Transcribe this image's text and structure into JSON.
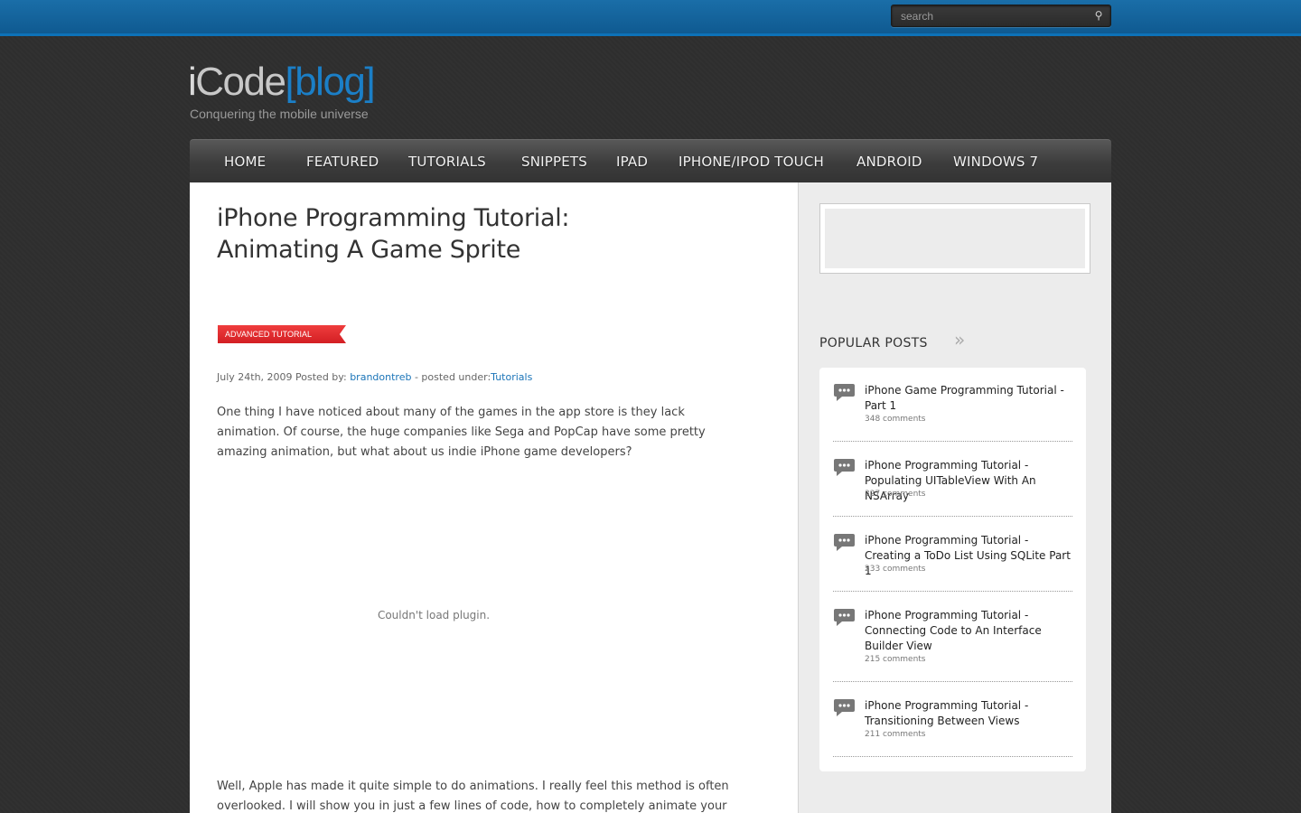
{
  "search": {
    "placeholder": "search"
  },
  "logo": {
    "i": "i",
    "code": "Code",
    "blog": "[blog]",
    "tagline": "Conquering the mobile universe"
  },
  "nav": [
    {
      "label": "HOME"
    },
    {
      "label": "FEATURED"
    },
    {
      "label": "TUTORIALS"
    },
    {
      "label": "SNIPPETS"
    },
    {
      "label": "IPAD"
    },
    {
      "label": "IPHONE/IPOD TOUCH"
    },
    {
      "label": "ANDROID"
    },
    {
      "label": "WINDOWS 7"
    }
  ],
  "post": {
    "title_line1": "iPhone Programming Tutorial:",
    "title_line2": "Animating A Game Sprite",
    "badge": "ADVANCED TUTORIAL",
    "date_prefix": "July 24th, 2009 Posted by: ",
    "author": "brandontreb",
    "posted_under": " - posted under:",
    "category": "Tutorials",
    "para1": "One thing I have noticed about many of the games in the app store is they lack animation. Of course, the huge companies like Sega and PopCap have some pretty amazing animation, but what about us indie iPhone game developers?",
    "plugin_message": "Couldn't load plugin.",
    "para2": "Well, Apple has made it quite simple to do animations. I really feel this method is often overlooked. I will show you in just a few lines of code, how to completely animate your game"
  },
  "sidebar": {
    "popular_title": "POPULAR POSTS",
    "popular_arrow": "»",
    "posts": [
      {
        "title": "iPhone Game Programming Tutorial - Part 1",
        "comments": "348 comments"
      },
      {
        "title": "iPhone Programming Tutorial - Populating UITableView With An NSArray",
        "comments": "327 comments"
      },
      {
        "title": "iPhone Programming Tutorial - Creating a ToDo List Using SQLite Part 1",
        "comments": "233 comments"
      },
      {
        "title": "iPhone Programming Tutorial - Connecting Code to An Interface Builder View",
        "comments": "215 comments"
      },
      {
        "title": "iPhone Programming Tutorial - Transitioning Between Views",
        "comments": "211 comments"
      }
    ]
  },
  "colors": {
    "accent": "#1b7fc7",
    "topbar": "#0f5a91",
    "badge": "#d31f24"
  },
  "icons": {
    "search": "search-icon",
    "comments": "speech-bubble-icon"
  }
}
